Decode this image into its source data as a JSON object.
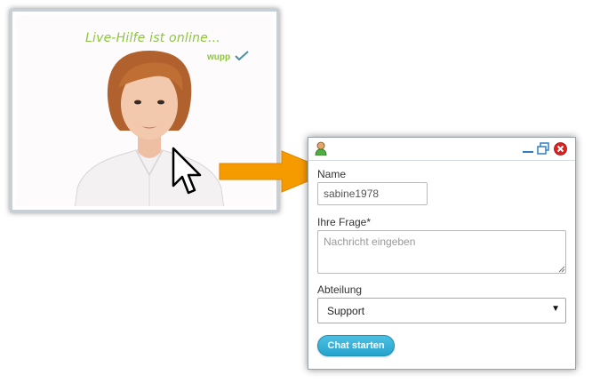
{
  "banner": {
    "headline": "Live-Hilfe ist online...",
    "brand": "wupp"
  },
  "chat": {
    "name_label": "Name",
    "name_value": "sabine1978",
    "question_label": "Ihre Frage*",
    "question_placeholder": "Nachricht eingeben",
    "department_label": "Abteilung",
    "department_selected": "Support",
    "department_caret": "▼",
    "start_button": "Chat starten"
  },
  "colors": {
    "headline": "#8dc63f",
    "arrow": "#f59b00",
    "button": "#26a3cd",
    "close": "#e0201e"
  },
  "icons": [
    "user-icon",
    "minimize-icon",
    "restore-icon",
    "close-icon",
    "mouse-cursor-icon",
    "arrow-icon",
    "resize-grip-icon"
  ]
}
